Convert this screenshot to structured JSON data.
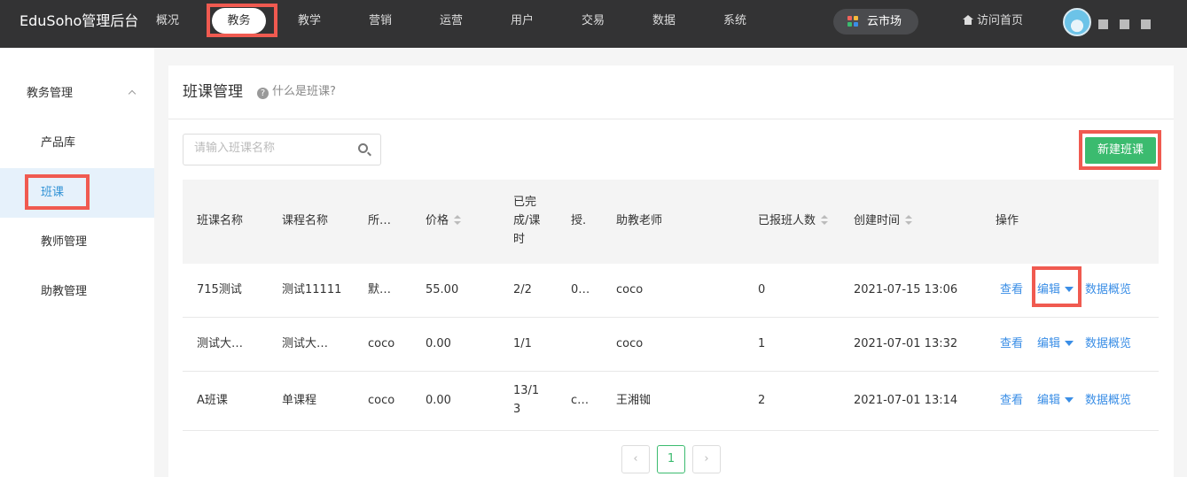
{
  "header": {
    "brand": "EduSoho管理后台",
    "nav": [
      "概况",
      "教务",
      "教学",
      "营销",
      "运营",
      "用户",
      "交易",
      "数据",
      "系统"
    ],
    "active_nav": "教务",
    "market": "云市场",
    "home": "访问首页",
    "colors": {
      "bar": "#333334",
      "highlight": "#f05a50"
    }
  },
  "sidebar": {
    "group": "教务管理",
    "items": [
      "产品库",
      "班课",
      "教师管理",
      "助教管理"
    ],
    "active": "班课"
  },
  "main": {
    "title": "班课管理",
    "help": "什么是班课?",
    "search_placeholder": "请输入班课名称",
    "new_button": "新建班课"
  },
  "table": {
    "headers": {
      "name": "班课名称",
      "course": "课程名称",
      "category": "所…",
      "price": "价格",
      "progress_1": "已完",
      "progress_2": "成/课",
      "progress_3": "时",
      "teacher": "授.",
      "assistant": "助教老师",
      "students": "已报班人数",
      "created": "创建时间",
      "actions": "操作"
    },
    "rows": [
      {
        "name": "715测试",
        "course": "测试11111",
        "category": "默…",
        "price": "55.00",
        "progress": "2/2",
        "progress_2": "",
        "teacher": "0…",
        "assistant": "coco",
        "students": "0",
        "created": "2021-07-15 13:06"
      },
      {
        "name": "测试大…",
        "course": "测试大…",
        "category": "coco",
        "price": "0.00",
        "progress": "1/1",
        "progress_2": "",
        "teacher": "",
        "assistant": "coco",
        "students": "1",
        "created": "2021-07-01 13:32"
      },
      {
        "name": "A班课",
        "course": "单课程",
        "category": "coco",
        "price": "0.00",
        "progress": "13/1",
        "progress_2": "3",
        "teacher": "c…",
        "assistant": "王湘铷",
        "students": "2",
        "created": "2021-07-01 13:14"
      }
    ],
    "actions": {
      "view": "查看",
      "edit": "编辑",
      "overview": "数据概览"
    }
  },
  "pagination": {
    "prev": "‹",
    "current": "1",
    "next": "›"
  }
}
